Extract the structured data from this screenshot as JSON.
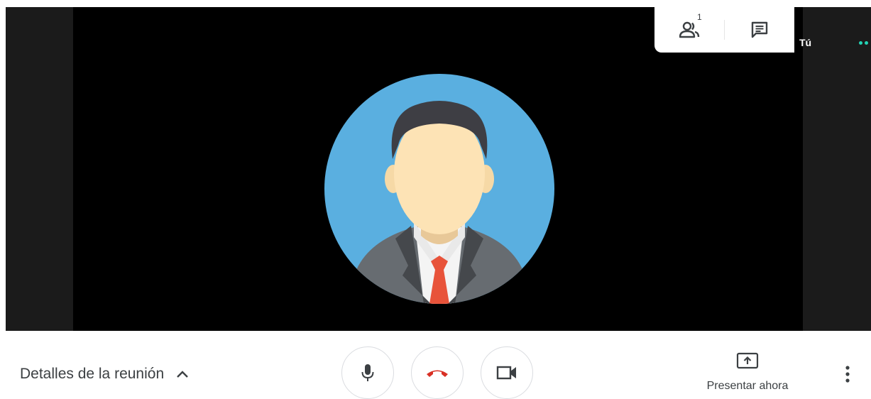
{
  "participants": {
    "count": "1",
    "icon": "people-icon"
  },
  "chat": {
    "icon": "chat-icon"
  },
  "self_tile": {
    "label": "Tú"
  },
  "meeting_details": {
    "label": "Detalles de la reunión",
    "icon": "chevron-up-icon"
  },
  "controls": {
    "mic_icon": "microphone-icon",
    "hangup_icon": "hang-up-icon",
    "camera_icon": "camera-icon"
  },
  "present": {
    "label": "Presentar ahora",
    "icon": "present-screen-icon"
  },
  "more": {
    "icon": "more-vert-icon"
  },
  "colors": {
    "avatar_bg": "#5aafe0",
    "hangup": "#d93025",
    "tie": "#e8533a",
    "self_indicator": "#23d2b4"
  }
}
